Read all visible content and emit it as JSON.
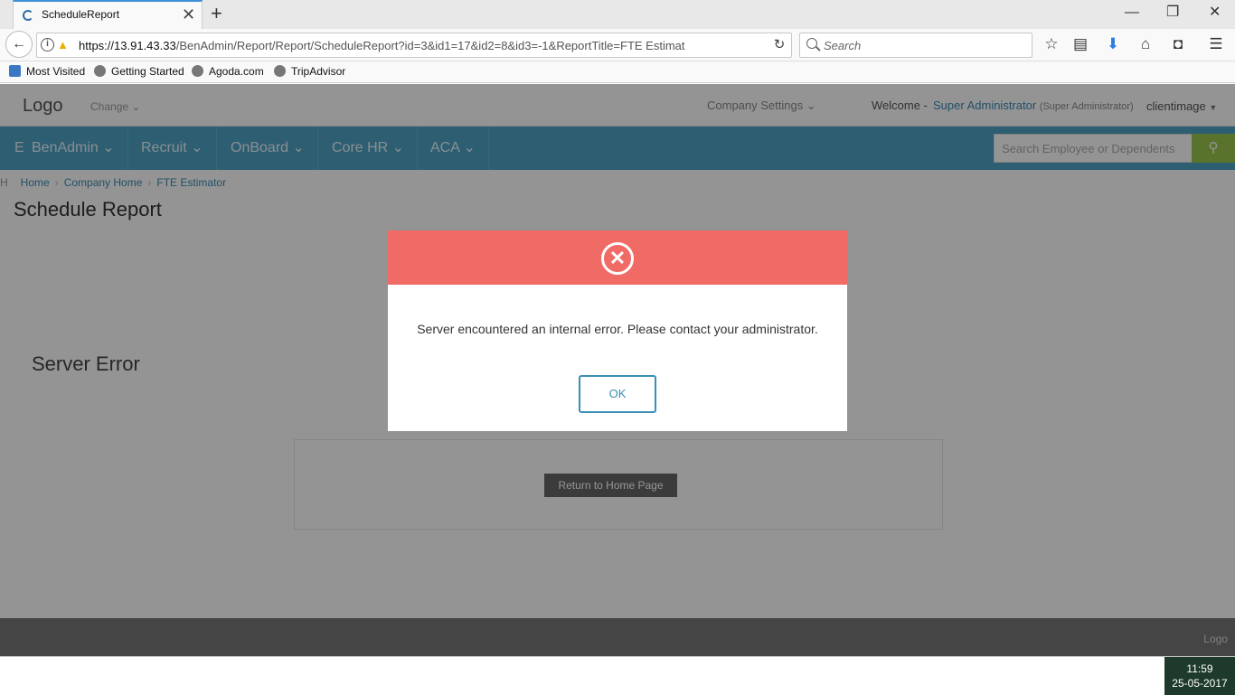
{
  "browser": {
    "tab_title": "ScheduleReport",
    "url_host": "https://13.91.43.33",
    "url_path": "/BenAdmin/Report/Report/ScheduleReport?id=3&id1=17&id2=8&id3=-1&ReportTitle=FTE Estimat",
    "search_placeholder": "Search",
    "bookmarks": [
      "Most Visited",
      "Getting Started",
      "Agoda.com",
      "TripAdvisor"
    ]
  },
  "app": {
    "logo": "Logo",
    "change": "Change",
    "company_settings": "Company Settings",
    "welcome": "Welcome -",
    "user_name": "Super Administrator",
    "user_role": "(Super Administrator)",
    "client": "clientimage",
    "nav": [
      "BenAdmin",
      "Recruit",
      "OnBoard",
      "Core HR",
      "ACA"
    ],
    "nav_stub": "E",
    "employee_search_placeholder": "Search Employee or Dependents",
    "breadcrumb": [
      "Home",
      "Company Home",
      "FTE Estimator"
    ],
    "breadcrumb_stub": "H",
    "page_title": "Schedule Report",
    "server_error": "Server Error",
    "return_button": "Return to Home Page",
    "footer_logo": "Logo"
  },
  "modal": {
    "message": "Server encountered an internal error. Please contact your administrator.",
    "ok_label": "OK",
    "header_color": "#f06a66"
  },
  "taskbar": {
    "time": "11:59",
    "date": "25-05-2017"
  }
}
